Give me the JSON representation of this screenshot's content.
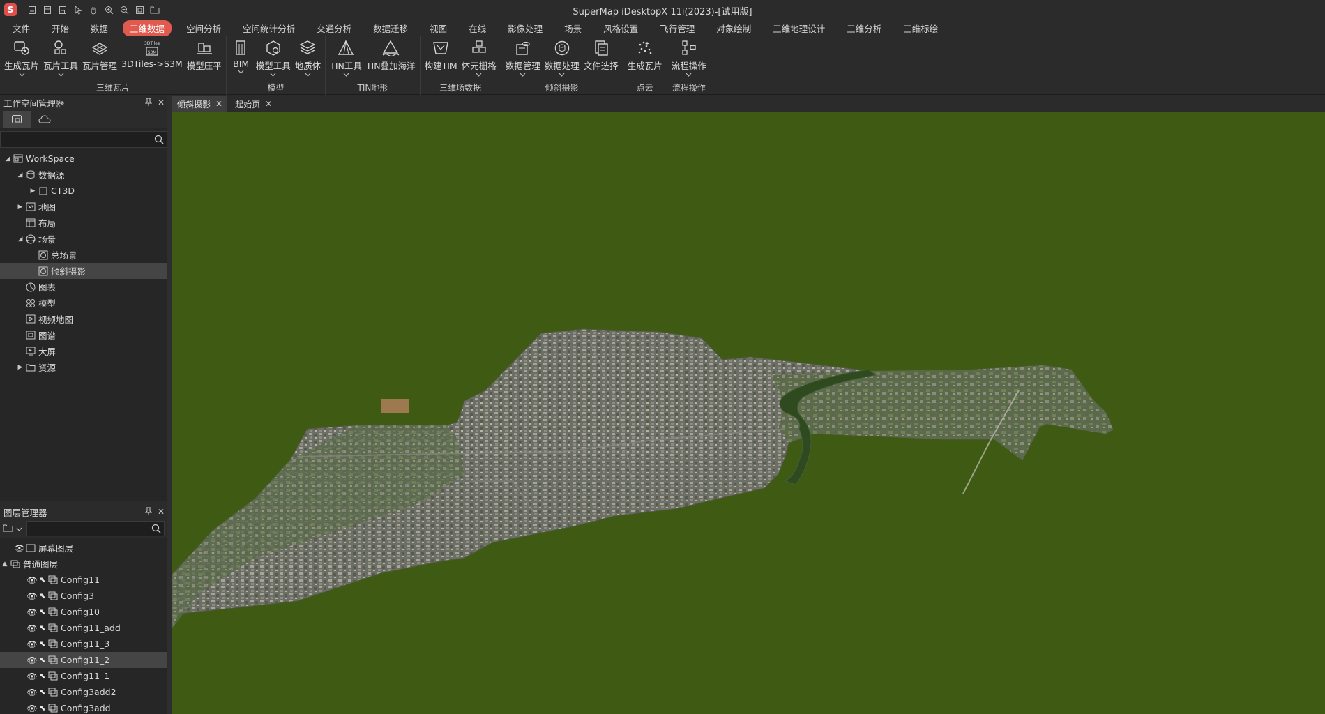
{
  "window": {
    "title": "SuperMap iDesktopX 11i(2023)-[试用版]",
    "logo": "S"
  },
  "menu": [
    "文件",
    "开始",
    "数据",
    "三维数据",
    "空间分析",
    "空间统计分析",
    "交通分析",
    "数据迁移",
    "视图",
    "在线",
    "影像处理",
    "场景",
    "风格设置",
    "飞行管理",
    "对象绘制",
    "三维地理设计",
    "三维分析",
    "三维标绘"
  ],
  "active_menu": "三维数据",
  "ribbon": {
    "groups": [
      {
        "label": "三维瓦片",
        "buttons": [
          {
            "label": "生成瓦片",
            "caret": true,
            "icon": "tile-generate-icon"
          },
          {
            "label": "瓦片工具",
            "caret": true,
            "icon": "tile-tools-icon"
          },
          {
            "label": "瓦片管理",
            "caret": false,
            "icon": "tile-manage-icon"
          },
          {
            "label": "3DTiles->S3M",
            "caret": false,
            "icon": "3dtiles-convert-icon",
            "badge_top": "3DTiles",
            "badge_bottom": "S3M"
          },
          {
            "label": "模型压平",
            "caret": false,
            "icon": "model-flatten-icon"
          }
        ]
      },
      {
        "label": "模型",
        "buttons": [
          {
            "label": "BIM",
            "caret": true,
            "icon": "bim-icon"
          },
          {
            "label": "模型工具",
            "caret": true,
            "icon": "model-tools-icon"
          },
          {
            "label": "地质体",
            "caret": true,
            "icon": "geology-body-icon"
          }
        ]
      },
      {
        "label": "TIN地形",
        "buttons": [
          {
            "label": "TIN工具",
            "caret": true,
            "icon": "tin-tools-icon"
          },
          {
            "label": "TIN叠加海洋",
            "caret": false,
            "icon": "tin-ocean-icon"
          }
        ]
      },
      {
        "label": "三维场数据",
        "buttons": [
          {
            "label": "构建TIM",
            "caret": false,
            "icon": "build-tim-icon"
          },
          {
            "label": "体元栅格",
            "caret": true,
            "icon": "voxel-grid-icon"
          }
        ]
      },
      {
        "label": "倾斜摄影",
        "buttons": [
          {
            "label": "数据管理",
            "caret": true,
            "icon": "data-manage-icon"
          },
          {
            "label": "数据处理",
            "caret": true,
            "icon": "data-process-icon"
          },
          {
            "label": "文件选择",
            "caret": false,
            "icon": "file-select-icon"
          }
        ]
      },
      {
        "label": "点云",
        "buttons": [
          {
            "label": "生成瓦片",
            "caret": false,
            "icon": "pointcloud-tile-icon"
          }
        ]
      },
      {
        "label": "流程操作",
        "buttons": [
          {
            "label": "流程操作",
            "caret": true,
            "icon": "workflow-icon"
          }
        ]
      }
    ]
  },
  "workspace_panel": {
    "title": "工作空间管理器",
    "search_placeholder": "",
    "tree": [
      {
        "label": "WorkSpace",
        "level": 0,
        "toggle": "▲",
        "icon": "workspace-icon"
      },
      {
        "label": "数据源",
        "level": 1,
        "toggle": "▲",
        "icon": "datasource-icon"
      },
      {
        "label": "CT3D",
        "level": 2,
        "toggle": "▶",
        "icon": "database-icon"
      },
      {
        "label": "地图",
        "level": 1,
        "toggle": "▶",
        "icon": "map-icon"
      },
      {
        "label": "布局",
        "level": 1,
        "toggle": "",
        "icon": "layout-icon"
      },
      {
        "label": "场景",
        "level": 1,
        "toggle": "▲",
        "icon": "scene-icon"
      },
      {
        "label": "总场景",
        "level": 2,
        "toggle": "",
        "icon": "scene-item-icon"
      },
      {
        "label": "倾斜摄影",
        "level": 2,
        "toggle": "",
        "icon": "scene-item-icon",
        "selected": true
      },
      {
        "label": "图表",
        "level": 1,
        "toggle": "",
        "icon": "chart-icon"
      },
      {
        "label": "模型",
        "level": 1,
        "toggle": "",
        "icon": "model-icon"
      },
      {
        "label": "视频地图",
        "level": 1,
        "toggle": "",
        "icon": "video-map-icon"
      },
      {
        "label": "图谱",
        "level": 1,
        "toggle": "",
        "icon": "atlas-icon"
      },
      {
        "label": "大屏",
        "level": 1,
        "toggle": "",
        "icon": "screen-icon"
      },
      {
        "label": "资源",
        "level": 1,
        "toggle": "▶",
        "icon": "folder-icon"
      }
    ]
  },
  "layer_panel": {
    "title": "图层管理器",
    "search_placeholder": "",
    "screen_layer": "屏幕图层",
    "normal_layer": "普通图层",
    "layers": [
      {
        "label": "Config11",
        "selected": false
      },
      {
        "label": "Config3",
        "selected": false
      },
      {
        "label": "Config10",
        "selected": false
      },
      {
        "label": "Config11_add",
        "selected": false
      },
      {
        "label": "Config11_3",
        "selected": false
      },
      {
        "label": "Config11_2",
        "selected": true
      },
      {
        "label": "Config11_1",
        "selected": false
      },
      {
        "label": "Config3add2",
        "selected": false
      },
      {
        "label": "Config3add",
        "selected": false
      }
    ]
  },
  "doc_tabs": [
    {
      "label": "倾斜摄影",
      "active": true
    },
    {
      "label": "起始页",
      "active": false
    }
  ],
  "colors": {
    "accent": "#e05a50",
    "background_ground": "#3e5a13",
    "panel": "#262626"
  }
}
